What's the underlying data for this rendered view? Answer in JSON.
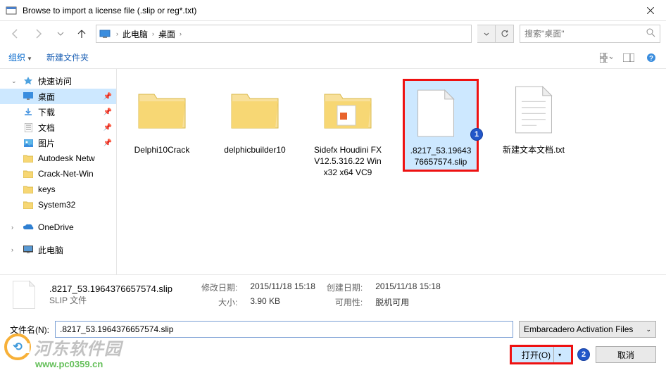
{
  "window": {
    "title": "Browse to import a license file (.slip or reg*.txt)"
  },
  "nav": {
    "breadcrumb": [
      "此电脑",
      "桌面"
    ],
    "search_placeholder": "搜索\"桌面\""
  },
  "toolbar": {
    "organize": "组织",
    "new_folder": "新建文件夹"
  },
  "sidebar": {
    "quick_access": "快速访问",
    "desktop": "桌面",
    "downloads": "下载",
    "documents": "文档",
    "pictures": "图片",
    "folders": [
      "Autodesk Netw",
      "Crack-Net-Win",
      "keys",
      "System32"
    ],
    "onedrive": "OneDrive",
    "this_pc": "此电脑"
  },
  "files": [
    {
      "name": "Delphi10Crack",
      "type": "folder"
    },
    {
      "name": "delphicbuilder10",
      "type": "folder"
    },
    {
      "name": "Sidefx Houdini FX V12.5.316.22 Win x32 x64 VC9",
      "type": "folder-doc"
    },
    {
      "name": ".8217_53.1964376657574.slip",
      "type": "file",
      "selected": true
    },
    {
      "name": "新建文本文档.txt",
      "type": "textfile"
    }
  ],
  "details": {
    "name": ".8217_53.1964376657574.slip",
    "type": "SLIP 文件",
    "mod_label": "修改日期:",
    "mod_value": "2015/11/18 15:18",
    "size_label": "大小:",
    "size_value": "3.90 KB",
    "created_label": "创建日期:",
    "created_value": "2015/11/18 15:18",
    "avail_label": "可用性:",
    "avail_value": "脱机可用"
  },
  "bottom": {
    "filename_label": "文件名(N):",
    "filename_value": ".8217_53.1964376657574.slip",
    "filter": "Embarcadero Activation Files",
    "open": "打开(O)",
    "cancel": "取消"
  },
  "watermark": {
    "text": "河东软件园",
    "url": "www.pc0359.cn"
  },
  "annotations": {
    "one": "1",
    "two": "2"
  }
}
